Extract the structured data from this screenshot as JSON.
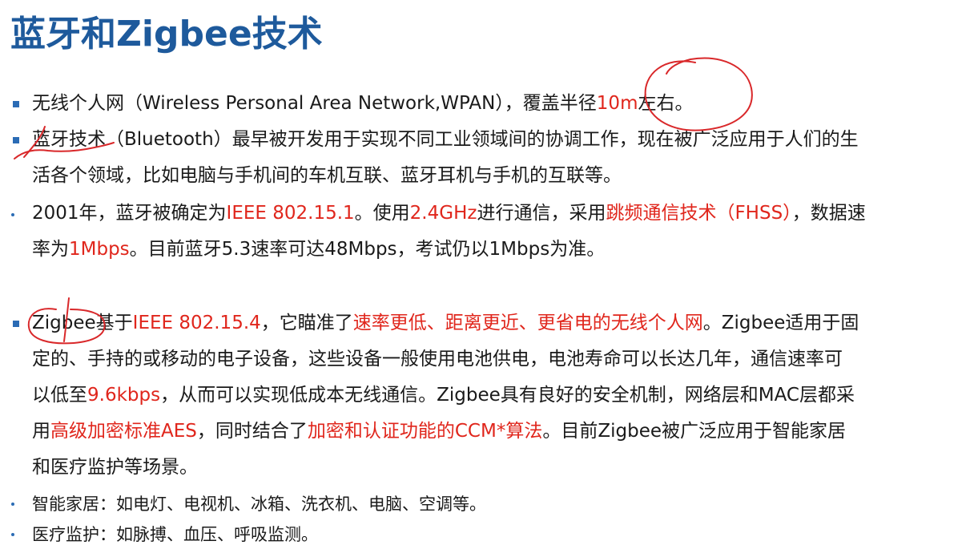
{
  "title": "蓝牙和Zigbee技术",
  "accent_color": "#1e5a9c",
  "highlight_color": "#e0261c",
  "annotation_color": "#d9282a",
  "b1": {
    "t1": "无线个人网（Wireless Personal Area Network,WPAN），覆盖半径",
    "r1": "10m",
    "t2": "左右。"
  },
  "b2": {
    "l1": "蓝牙技术（Bluetooth）最早被开发用于实现不同工业领域间的协调工作，现在被广泛应用于人们的生",
    "l2": "活各个领域，比如电脑与手机间的车机互联、蓝牙耳机与手机的互联等。"
  },
  "b3": {
    "t1": "2001年，蓝牙被确定为",
    "r1": "IEEE 802.15.1",
    "t2": "。使用",
    "r2": "2.4GHz",
    "t3": "进行通信，采用",
    "r3": "跳频通信技术（FHSS）",
    "t4": "，数据速",
    "t5": "率为",
    "r4": "1Mbps",
    "t6": "。目前蓝牙5.3速率可达48Mbps，考试仍以1Mbps为准。"
  },
  "b4": {
    "t1": "Zigbee基于",
    "r1": "IEEE 802.15.4",
    "t2": "，它瞄准了",
    "r2": "速率更低、距离更近、更省电的无线个人网",
    "t3": "。Zigbee适用于固",
    "l2": "定的、手持的或移动的电子设备，这些设备一般使用电池供电，电池寿命可以长达几年，通信速率可",
    "t4": "以低至",
    "r3": "9.6kbps",
    "t5": "，从而可以实现低成本无线通信。Zigbee具有良好的安全机制，网络层和MAC层都采",
    "t6": "用",
    "r4": "高级加密标准AES",
    "t7": "，同时结合了",
    "r5": "加密和认证功能的CCM*算法",
    "t8": "。目前Zigbee被广泛应用于智能家居",
    "l5": "和医疗监护等场景。"
  },
  "sub1": "智能家居：如电灯、电视机、冰箱、洗衣机、电脑、空调等。",
  "sub2": "医疗监护：如脉搏、血压、呼吸监测。"
}
